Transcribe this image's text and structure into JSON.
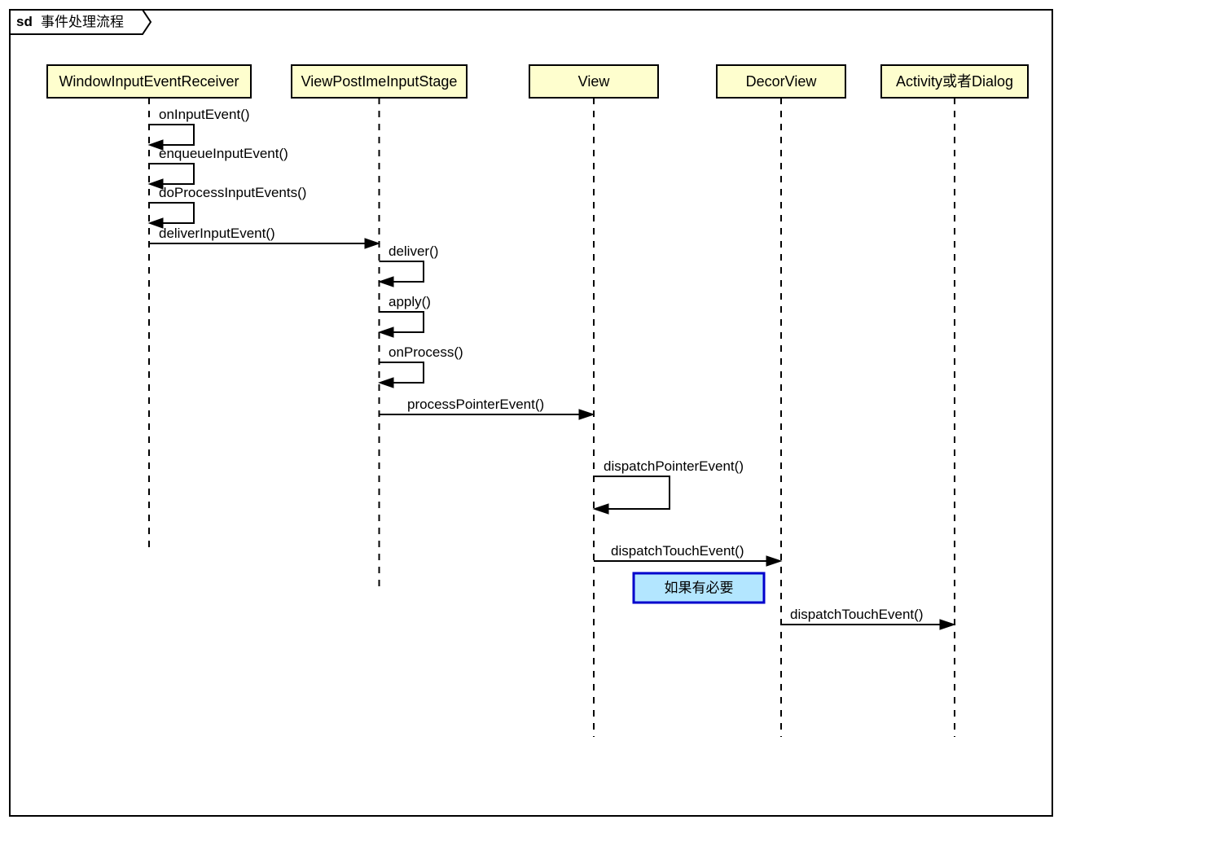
{
  "frame": {
    "prefix": "sd",
    "title": "事件处理流程"
  },
  "participants": [
    {
      "id": "p0",
      "label": "WindowInputEventReceiver"
    },
    {
      "id": "p1",
      "label": "ViewPostImeInputStage"
    },
    {
      "id": "p2",
      "label": "View"
    },
    {
      "id": "p3",
      "label": "DecorView"
    },
    {
      "id": "p4",
      "label": "Activity或者Dialog"
    }
  ],
  "messages": [
    {
      "id": "m0",
      "label": "onInputEvent()"
    },
    {
      "id": "m1",
      "label": "enqueueInputEvent()"
    },
    {
      "id": "m2",
      "label": "doProcessInputEvents()"
    },
    {
      "id": "m3",
      "label": "deliverInputEvent()"
    },
    {
      "id": "m4",
      "label": "deliver()"
    },
    {
      "id": "m5",
      "label": "apply()"
    },
    {
      "id": "m6",
      "label": "onProcess()"
    },
    {
      "id": "m7",
      "label": "processPointerEvent()"
    },
    {
      "id": "m8",
      "label": "dispatchPointerEvent()"
    },
    {
      "id": "m9",
      "label": "dispatchTouchEvent()"
    },
    {
      "id": "m10",
      "label": "dispatchTouchEvent()"
    }
  ],
  "note": {
    "text": "如果有必要"
  }
}
